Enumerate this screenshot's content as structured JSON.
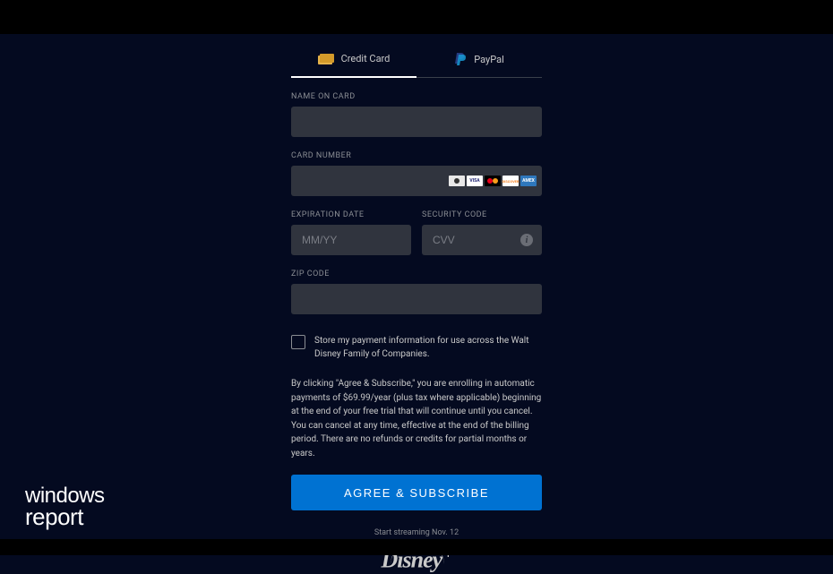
{
  "tabs": {
    "credit_card": "Credit Card",
    "paypal": "PayPal"
  },
  "fields": {
    "name": {
      "label": "NAME ON CARD",
      "value": "",
      "placeholder": ""
    },
    "card": {
      "label": "CARD NUMBER",
      "value": "",
      "placeholder": ""
    },
    "exp": {
      "label": "EXPIRATION DATE",
      "value": "",
      "placeholder": "MM/YY"
    },
    "cvv": {
      "label": "SECURITY CODE",
      "value": "",
      "placeholder": "CVV"
    },
    "zip": {
      "label": "ZIP CODE",
      "value": "",
      "placeholder": ""
    }
  },
  "card_brands": {
    "visa": "VISA",
    "discover": "DISCOVER",
    "amex": "AMEX"
  },
  "checkbox": {
    "text": "Store my payment information for use across the Walt Disney Family of Companies."
  },
  "disclaimer": "By clicking \"Agree & Subscribe,\" you are enrolling in automatic payments of $69.99/year (plus tax where applicable) beginning at the end of your free trial that will continue until you cancel. You can cancel at any time, effective at the end of the billing period. There are no refunds or credits for partial months or years.",
  "submit": "AGREE & SUBSCRIBE",
  "streaming_note": "Start streaming Nov. 12",
  "logo_text": "Disney",
  "logo_plus": "+",
  "watermark": {
    "line1": "windows",
    "line2": "report"
  }
}
